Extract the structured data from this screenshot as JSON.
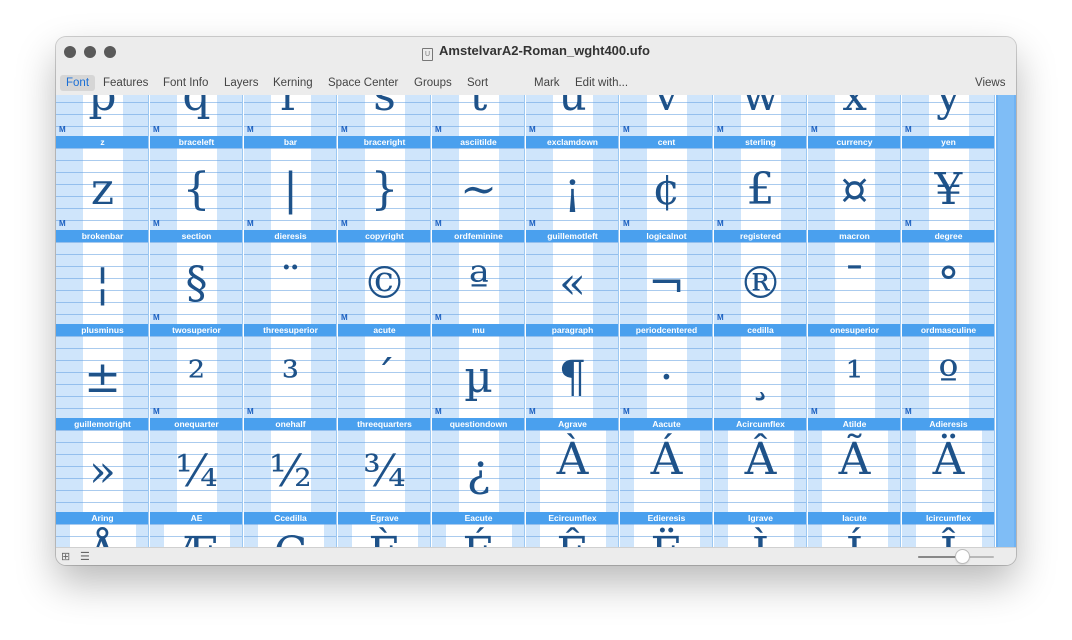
{
  "window": {
    "title": "AmstelvarA2-Roman_wght400.ufo",
    "doc_icon": "U"
  },
  "menu": {
    "items": [
      "Font",
      "Features",
      "Font Info",
      "Layers",
      "Kerning",
      "Space Center",
      "Groups",
      "Sort",
      "Mark",
      "Edit with..."
    ],
    "active": "Font",
    "views": "Views"
  },
  "colors": {
    "label_bg": "#4aa0ee",
    "cell_bg": "#cfe5fb",
    "glyph": "#1e5289",
    "scrollbar": "#6fb2f3"
  },
  "mark_letter": "M",
  "rows": [
    [
      {
        "name": "",
        "char": "p",
        "mark": true
      },
      {
        "name": "",
        "char": "q",
        "mark": true
      },
      {
        "name": "",
        "char": "r",
        "mark": true
      },
      {
        "name": "",
        "char": "s",
        "mark": true
      },
      {
        "name": "",
        "char": "t",
        "mark": true
      },
      {
        "name": "",
        "char": "u",
        "mark": true
      },
      {
        "name": "",
        "char": "v",
        "mark": true
      },
      {
        "name": "",
        "char": "w",
        "mark": true
      },
      {
        "name": "",
        "char": "x",
        "mark": true
      },
      {
        "name": "",
        "char": "y",
        "mark": true
      }
    ],
    [
      {
        "name": "z",
        "char": "z",
        "mark": true
      },
      {
        "name": "braceleft",
        "char": "{",
        "mark": true
      },
      {
        "name": "bar",
        "char": "|",
        "mark": true
      },
      {
        "name": "braceright",
        "char": "}",
        "mark": true
      },
      {
        "name": "asciitilde",
        "char": "~",
        "mark": true
      },
      {
        "name": "exclamdown",
        "char": "¡",
        "mark": true
      },
      {
        "name": "cent",
        "char": "¢",
        "mark": true
      },
      {
        "name": "sterling",
        "char": "£",
        "mark": true
      },
      {
        "name": "currency",
        "char": "¤",
        "mark": false
      },
      {
        "name": "yen",
        "char": "¥",
        "mark": true
      }
    ],
    [
      {
        "name": "brokenbar",
        "char": "¦",
        "mark": false
      },
      {
        "name": "section",
        "char": "§",
        "mark": true
      },
      {
        "name": "dieresis",
        "char": "¨",
        "mark": false
      },
      {
        "name": "copyright",
        "char": "©",
        "mark": true
      },
      {
        "name": "ordfeminine",
        "char": "ª",
        "mark": true
      },
      {
        "name": "guillemotleft",
        "char": "«",
        "mark": false
      },
      {
        "name": "logicalnot",
        "char": "¬",
        "mark": false
      },
      {
        "name": "registered",
        "char": "®",
        "mark": true
      },
      {
        "name": "macron",
        "char": "¯",
        "mark": false
      },
      {
        "name": "degree",
        "char": "°",
        "mark": false
      }
    ],
    [
      {
        "name": "plusminus",
        "char": "±",
        "mark": false
      },
      {
        "name": "twosuperior",
        "char": "²",
        "mark": true
      },
      {
        "name": "threesuperior",
        "char": "³",
        "mark": true
      },
      {
        "name": "acute",
        "char": "´",
        "mark": false
      },
      {
        "name": "mu",
        "char": "µ",
        "mark": true
      },
      {
        "name": "paragraph",
        "char": "¶",
        "mark": true
      },
      {
        "name": "periodcentered",
        "char": "·",
        "mark": true
      },
      {
        "name": "cedilla",
        "char": "¸",
        "mark": false
      },
      {
        "name": "onesuperior",
        "char": "¹",
        "mark": true
      },
      {
        "name": "ordmasculine",
        "char": "º",
        "mark": true
      }
    ],
    [
      {
        "name": "guillemotright",
        "char": "»",
        "mark": false
      },
      {
        "name": "onequarter",
        "char": "¼",
        "mark": false
      },
      {
        "name": "onehalf",
        "char": "½",
        "mark": false
      },
      {
        "name": "threequarters",
        "char": "¾",
        "mark": false
      },
      {
        "name": "questiondown",
        "char": "¿",
        "mark": false
      },
      {
        "name": "Agrave",
        "char": "À",
        "mark": false
      },
      {
        "name": "Aacute",
        "char": "Á",
        "mark": false
      },
      {
        "name": "Acircumflex",
        "char": "Â",
        "mark": false
      },
      {
        "name": "Atilde",
        "char": "Ã",
        "mark": false
      },
      {
        "name": "Adieresis",
        "char": "Ä",
        "mark": false
      }
    ],
    [
      {
        "name": "Aring",
        "char": "Å",
        "mark": false
      },
      {
        "name": "AE",
        "char": "Æ",
        "mark": false
      },
      {
        "name": "Ccedilla",
        "char": "Ç",
        "mark": false
      },
      {
        "name": "Egrave",
        "char": "È",
        "mark": false
      },
      {
        "name": "Eacute",
        "char": "É",
        "mark": false
      },
      {
        "name": "Ecircumflex",
        "char": "Ê",
        "mark": false
      },
      {
        "name": "Edieresis",
        "char": "Ë",
        "mark": false
      },
      {
        "name": "Igrave",
        "char": "Ì",
        "mark": false
      },
      {
        "name": "Iacute",
        "char": "Í",
        "mark": false
      },
      {
        "name": "Icircumflex",
        "char": "Î",
        "mark": false
      }
    ]
  ],
  "bottom_bar": {
    "grid_view_icon": "grid-view-icon",
    "list_view_icon": "list-view-icon",
    "glyph_size_slider": 0.58
  }
}
